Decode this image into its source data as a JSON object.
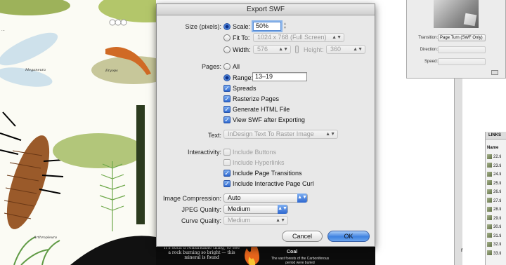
{
  "dialog": {
    "title": "Export SWF",
    "size_label": "Size (pixels):",
    "scale_label": "Scale:",
    "scale_value": "50%",
    "fit_label": "Fit To:",
    "fit_value": "1024 x 768 (Full Screen)",
    "width_label": "Width:",
    "width_value": "576",
    "height_label": "Height:",
    "height_value": "360",
    "pages_label": "Pages:",
    "all_label": "All",
    "range_label": "Range:",
    "range_value": "13–19",
    "spreads_label": "Spreads",
    "rasterize_label": "Rasterize Pages",
    "html_label": "Generate HTML File",
    "view_label": "View SWF after Exporting",
    "text_label": "Text:",
    "text_value": "InDesign Text To Raster Image",
    "interactivity_label": "Interactivity:",
    "buttons_label": "Include Buttons",
    "hyperlinks_label": "Include Hyperlinks",
    "transitions_label": "Include Page Transitions",
    "curl_label": "Include Interactive Page Curl",
    "compression_label": "Image Compression:",
    "compression_value": "Auto",
    "jpeg_label": "JPEG Quality:",
    "jpeg_value": "Medium",
    "curve_label": "Curve Quality:",
    "curve_value": "Medium",
    "cancel_label": "Cancel",
    "ok_label": "OK"
  },
  "transition_panel": {
    "transition_label": "Transition:",
    "transition_value": "Page Turn (SWF Only)",
    "direction_label": "Direction:",
    "speed_label": "Speed:"
  },
  "links_panel": {
    "tab": "LINKS",
    "header": "Name",
    "items": [
      "22.ti",
      "23.ti",
      "24.ti",
      "25.ti",
      "26.ti",
      "27.ti",
      "28.ti",
      "29.ti",
      "30.ti",
      "31.ti",
      "32.ti",
      "33.ti"
    ]
  },
  "background_text": {
    "cap_dragonfly_a": "Meganeura",
    "cap_salamander": "Eryops",
    "cap_spider": "Arthropleura",
    "cap_dragonfly_b": "dragonfly",
    "cap_top": "...",
    "bottom_left": "It's such a remarkable thing, to see a rock burning so bright — this mineral is found",
    "bottom_right_title": "Coal",
    "bottom_right_body": "The vast forests of the Carboniferous period were buried"
  },
  "colors": {
    "accent": "#2d67cf",
    "dialog_bg": "#e8e8e8"
  }
}
